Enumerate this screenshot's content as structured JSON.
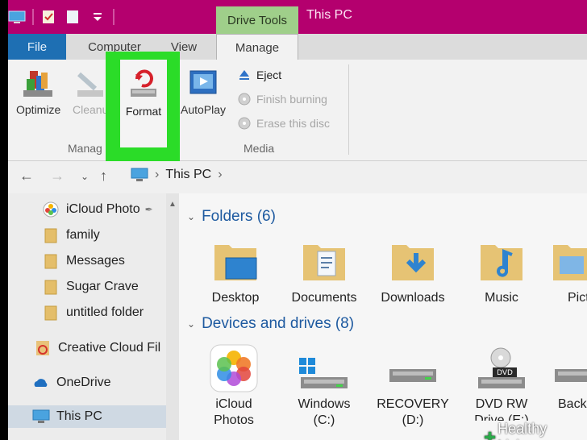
{
  "window": {
    "title": "This PC",
    "context_tab": "Drive Tools"
  },
  "tabs": {
    "file": "File",
    "computer": "Computer",
    "view": "View",
    "manage": "Manage"
  },
  "ribbon": {
    "optimize": "Optimize",
    "cleanup": "Cleanu",
    "format": "Format",
    "autoplay": "AutoPlay",
    "eject": "Eject",
    "finish_burning": "Finish burning",
    "erase_disc": "Erase this disc",
    "group_manage": "Manag",
    "group_media": "Media"
  },
  "address": {
    "crumb": "This PC"
  },
  "nav": {
    "items": [
      "iCloud Photo",
      "family",
      "Messages",
      "Sugar Crave",
      "untitled folder",
      "Creative Cloud Fil",
      "OneDrive",
      "This PC"
    ]
  },
  "folders": {
    "heading": "Folders (6)",
    "items": [
      "Desktop",
      "Documents",
      "Downloads",
      "Music",
      "Pict"
    ]
  },
  "devices": {
    "heading": "Devices and drives (8)",
    "items": [
      {
        "line1": "iCloud",
        "line2": "Photos"
      },
      {
        "line1": "Windows",
        "line2": "(C:)"
      },
      {
        "line1": "RECOVERY",
        "line2": "(D:)"
      },
      {
        "line1": "DVD RW",
        "line2": "Drive (E:)"
      },
      {
        "line1": "Back",
        "line2": ""
      }
    ]
  },
  "watermark": "Healthy Living",
  "colors": {
    "titlebar": "#b4006e",
    "accent": "#1e6fb3",
    "highlight": "#2bdc28"
  }
}
